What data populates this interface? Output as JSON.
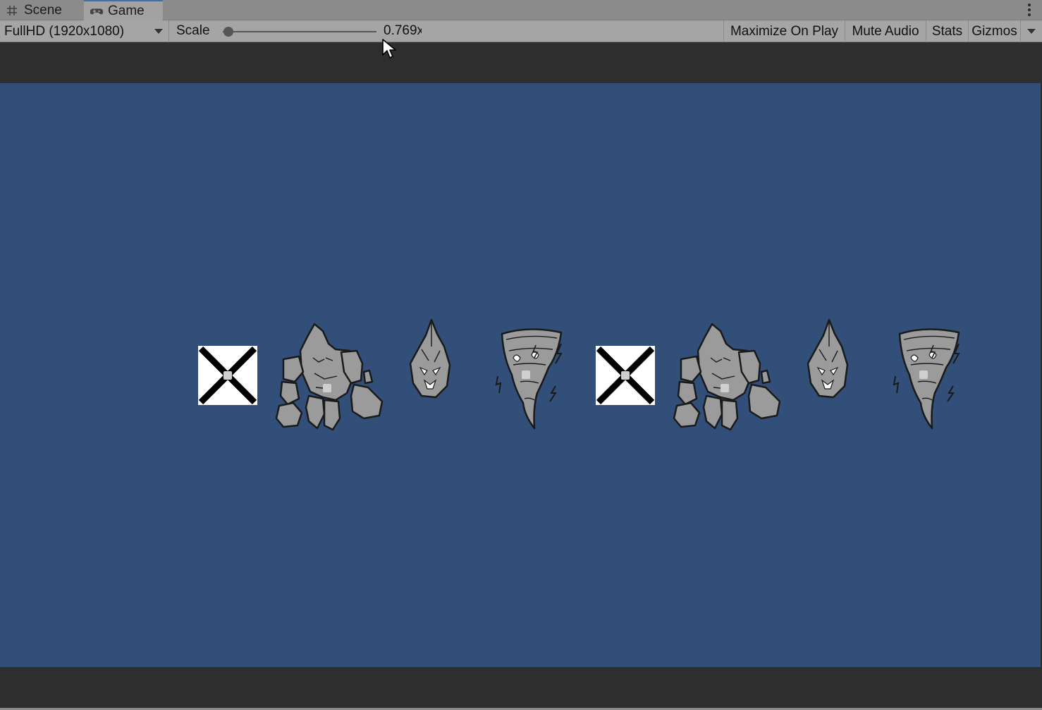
{
  "tabs": [
    {
      "label": "Scene",
      "icon": "grid-hash-icon",
      "active": false
    },
    {
      "label": "Game",
      "icon": "gamepad-icon",
      "active": true
    }
  ],
  "toolbar": {
    "resolution": "FullHD (1920x1080)",
    "scale_label": "Scale",
    "scale_value": "0.769x",
    "scale_fraction": 0.0,
    "maximize_on_play": "Maximize On Play",
    "mute_audio": "Mute Audio",
    "stats": "Stats",
    "gizmos": "Gizmos"
  },
  "game_view": {
    "background_color": "#314f79",
    "sprites": [
      {
        "type": "missing-texture-x"
      },
      {
        "type": "rock-golem"
      },
      {
        "type": "rock-shard"
      },
      {
        "type": "storm-tornado"
      },
      {
        "type": "missing-texture-x"
      },
      {
        "type": "rock-golem"
      },
      {
        "type": "rock-shard"
      },
      {
        "type": "storm-tornado"
      }
    ]
  },
  "colors": {
    "accent": "#3a72b0",
    "tabbar": "#8b8b8b",
    "toolbar": "#a5a5a5"
  }
}
